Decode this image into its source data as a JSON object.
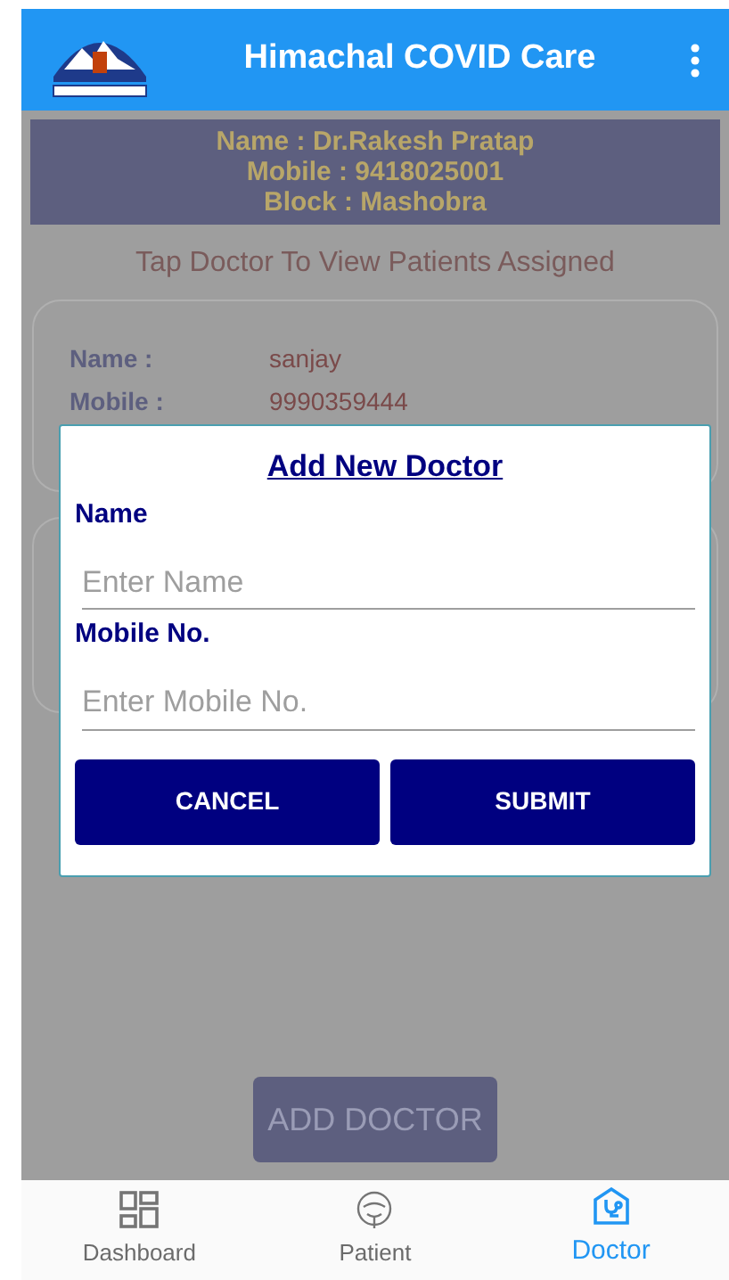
{
  "app_bar": {
    "title": "Himachal COVID Care"
  },
  "profile": [
    "Name :  Dr.Rakesh Pratap",
    "Mobile : 9418025001",
    "Block : Mashobra"
  ],
  "hint": "Tap Doctor To View Patients Assigned",
  "doctors": [
    {
      "name_label": "Name :",
      "name": "sanjay",
      "mobile_label": "Mobile  :",
      "mobile": "9990359444"
    }
  ],
  "add_button": "ADD DOCTOR",
  "dialog": {
    "title": "Add New Doctor",
    "fields": [
      {
        "label": "Name",
        "placeholder": "Enter Name"
      },
      {
        "label": "Mobile No.",
        "placeholder": "Enter Mobile No."
      }
    ],
    "buttons": [
      "CANCEL",
      "SUBMIT"
    ]
  },
  "bottom_nav": [
    {
      "kind": "dashboard",
      "label": "Dashboard",
      "selected": false
    },
    {
      "kind": "patient",
      "label": "Patient",
      "selected": false
    },
    {
      "kind": "doctor",
      "label": "Doctor",
      "selected": true
    }
  ]
}
